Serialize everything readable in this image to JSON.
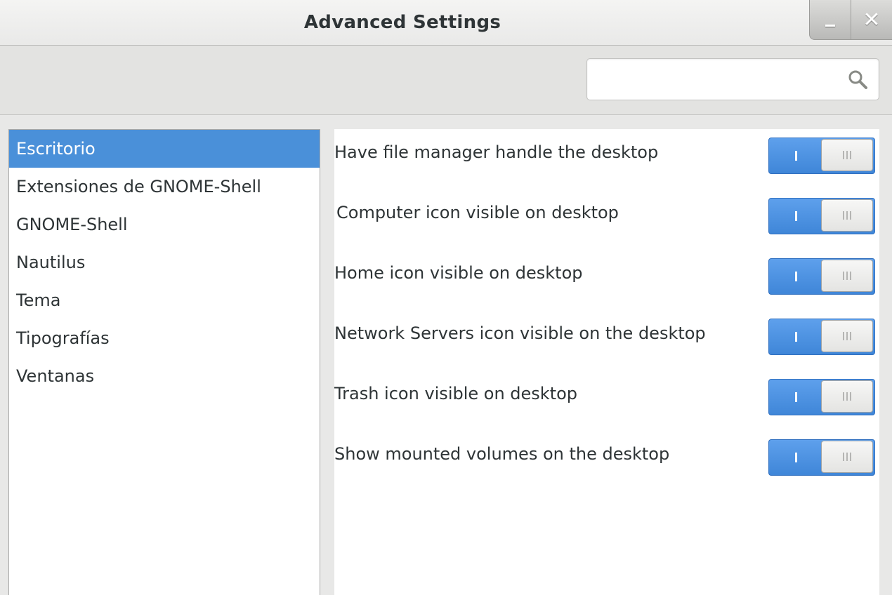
{
  "window": {
    "title": "Advanced Settings",
    "minimize_icon": "minimize-icon",
    "close_symbol": "✕",
    "close_icon": "close-icon"
  },
  "toolbar": {
    "search": {
      "value": "",
      "placeholder": "",
      "icon": "search-icon"
    }
  },
  "sidebar": {
    "items": [
      {
        "label": "Escritorio",
        "selected": true
      },
      {
        "label": "Extensiones de GNOME-Shell",
        "selected": false
      },
      {
        "label": "GNOME-Shell",
        "selected": false
      },
      {
        "label": "Nautilus",
        "selected": false
      },
      {
        "label": "Tema",
        "selected": false
      },
      {
        "label": "Tipografías",
        "selected": false
      },
      {
        "label": "Ventanas",
        "selected": false
      }
    ]
  },
  "settings": {
    "rows": [
      {
        "label": "Have file manager handle the desktop",
        "state": "on"
      },
      {
        "label": "Computer icon visible on desktop",
        "state": "on"
      },
      {
        "label": "Home icon visible on desktop",
        "state": "on"
      },
      {
        "label": "Network Servers icon visible on the desktop",
        "state": "on"
      },
      {
        "label": "Trash icon visible on desktop",
        "state": "on"
      },
      {
        "label": "Show mounted volumes on the desktop",
        "state": "on"
      }
    ]
  },
  "colors": {
    "accent": "#4a90d9",
    "switch_on": "#4a90d9"
  }
}
